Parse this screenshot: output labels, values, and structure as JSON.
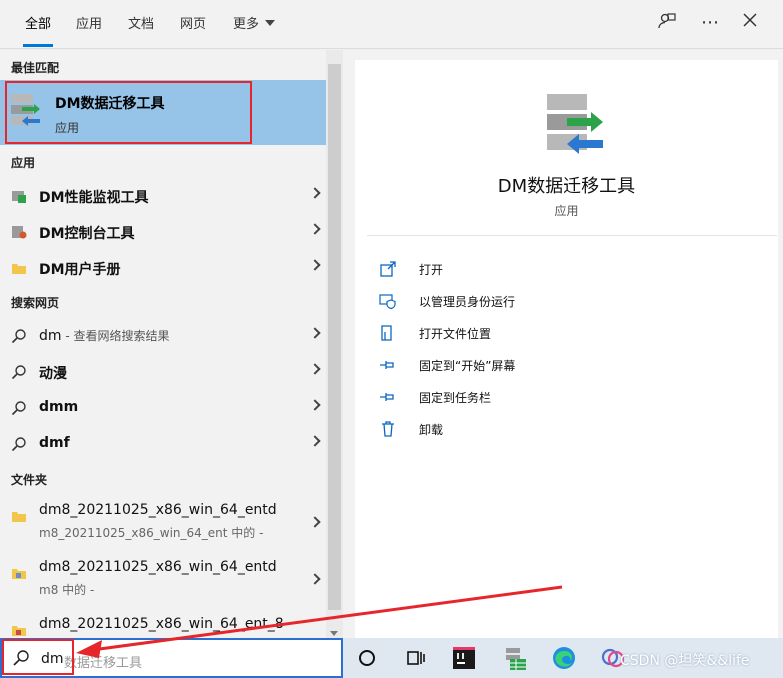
{
  "tabs": [
    {
      "label": "全部",
      "active": true
    },
    {
      "label": "应用"
    },
    {
      "label": "文档"
    },
    {
      "label": "网页"
    },
    {
      "label": "更多"
    }
  ],
  "top_icons": [
    "feedback-icon",
    "more-icon",
    "close-icon"
  ],
  "sections": {
    "best_match": "最佳匹配",
    "apps": "应用",
    "web": "搜索网页",
    "folders": "文件夹"
  },
  "best_match": {
    "title": "DM数据迁移工具",
    "subtitle": "应用"
  },
  "apps": [
    {
      "label": "DM性能监视工具"
    },
    {
      "label": "DM控制台工具"
    },
    {
      "label": "DM用户手册"
    }
  ],
  "web": [
    {
      "bold": "dm",
      "rest": " - 查看网络搜索结果"
    },
    {
      "bold": "动漫",
      "rest": ""
    },
    {
      "bold": "dmm",
      "rest": ""
    },
    {
      "bold": "dmf",
      "rest": ""
    }
  ],
  "folders": [
    {
      "title": "dm8_20211025_x86_win_64_entd",
      "sub": "m8_20211025_x86_win_64_ent 中的 -"
    },
    {
      "title": "dm8_20211025_x86_win_64_entd",
      "sub": "m8 中的 -"
    },
    {
      "title": "dm8_20211025_x86_win_64_ent_8",
      "sub": ""
    }
  ],
  "detail": {
    "name": "DM数据迁移工具",
    "type": "应用",
    "actions": [
      {
        "label": "打开",
        "icon": "open-icon"
      },
      {
        "label": "以管理员身份运行",
        "icon": "shield-icon"
      },
      {
        "label": "打开文件位置",
        "icon": "folder-location-icon"
      },
      {
        "label": "固定到“开始”屏幕",
        "icon": "pin-icon"
      },
      {
        "label": "固定到任务栏",
        "icon": "pin-icon"
      },
      {
        "label": "卸载",
        "icon": "trash-icon"
      }
    ]
  },
  "search": {
    "typed": "dm",
    "ghost": "数据迁移工具"
  },
  "watermark": "CSDN @坦笑&&life",
  "colors": {
    "accent": "#0078d7",
    "highlight": "#96c4e8",
    "annotation": "#e6262a"
  }
}
